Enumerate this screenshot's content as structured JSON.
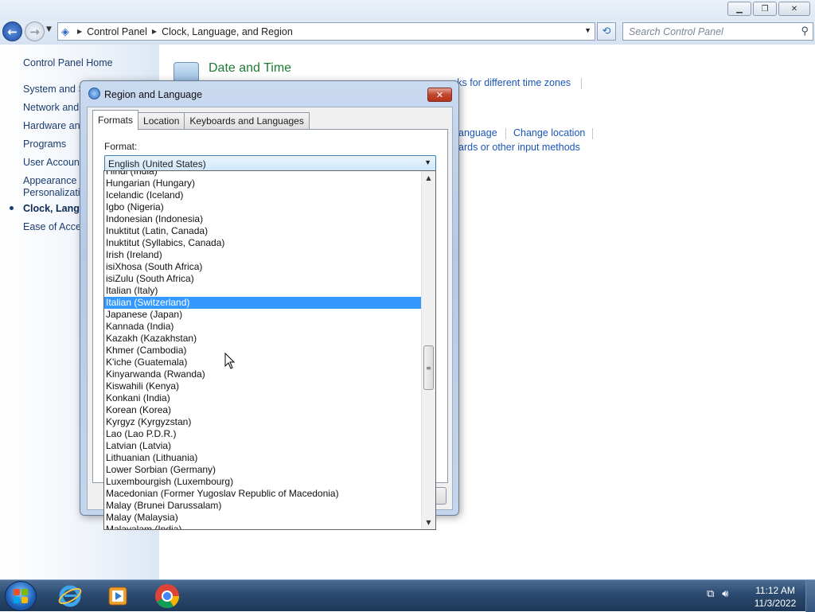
{
  "window": {
    "minimize_icon": "minimize-icon",
    "maximize_icon": "restore-icon",
    "close_icon": "close-icon"
  },
  "nav": {
    "back_icon": "back-arrow-icon",
    "forward_icon": "forward-arrow-icon",
    "breadcrumb": [
      "Control Panel",
      "Clock, Language, and Region"
    ],
    "search_placeholder": "Search Control Panel"
  },
  "sidebar": {
    "items": [
      "Control Panel Home",
      "System and S",
      "Network and",
      "Hardware and",
      "Programs",
      "User Account",
      "Appearance a",
      "Personalizati",
      "Clock, Langua",
      "Ease of Acces"
    ]
  },
  "content": {
    "heading": "Date and Time",
    "link_time_zones": "cks for different time zones",
    "link_language": "anguage",
    "link_change_location": "Change location",
    "link_keyboards": "ards or other input methods"
  },
  "dialog": {
    "title": "Region and Language",
    "tabs": [
      "Formats",
      "Location",
      "Keyboards and Languages"
    ],
    "format_label": "Format:",
    "format_value": "English (United States)",
    "list_items": [
      "Hindi (India)",
      "Hungarian (Hungary)",
      "Icelandic (Iceland)",
      "Igbo (Nigeria)",
      "Indonesian (Indonesia)",
      "Inuktitut (Latin, Canada)",
      "Inuktitut (Syllabics, Canada)",
      "Irish (Ireland)",
      "isiXhosa (South Africa)",
      "isiZulu (South Africa)",
      "Italian (Italy)",
      "Italian (Switzerland)",
      "Japanese (Japan)",
      "Kannada (India)",
      "Kazakh (Kazakhstan)",
      "Khmer (Cambodia)",
      "K'iche (Guatemala)",
      "Kinyarwanda (Rwanda)",
      "Kiswahili (Kenya)",
      "Konkani (India)",
      "Korean (Korea)",
      "Kyrgyz (Kyrgyzstan)",
      "Lao (Lao P.D.R.)",
      "Latvian (Latvia)",
      "Lithuanian (Lithuania)",
      "Lower Sorbian (Germany)",
      "Luxembourgish (Luxembourg)",
      "Macedonian (Former Yugoslav Republic of Macedonia)",
      "Malay (Brunei Darussalam)",
      "Malay (Malaysia)",
      "Malayalam (India)"
    ],
    "selected_item": "Italian (Switzerland)"
  },
  "taskbar": {
    "apps": [
      "internet-explorer-icon",
      "media-player-icon",
      "chrome-icon"
    ],
    "time": "11:12 AM",
    "date": "11/3/2022"
  },
  "colors": {
    "accent": "#3399ff",
    "link": "#1a56b6",
    "heading": "#1d7b36"
  }
}
